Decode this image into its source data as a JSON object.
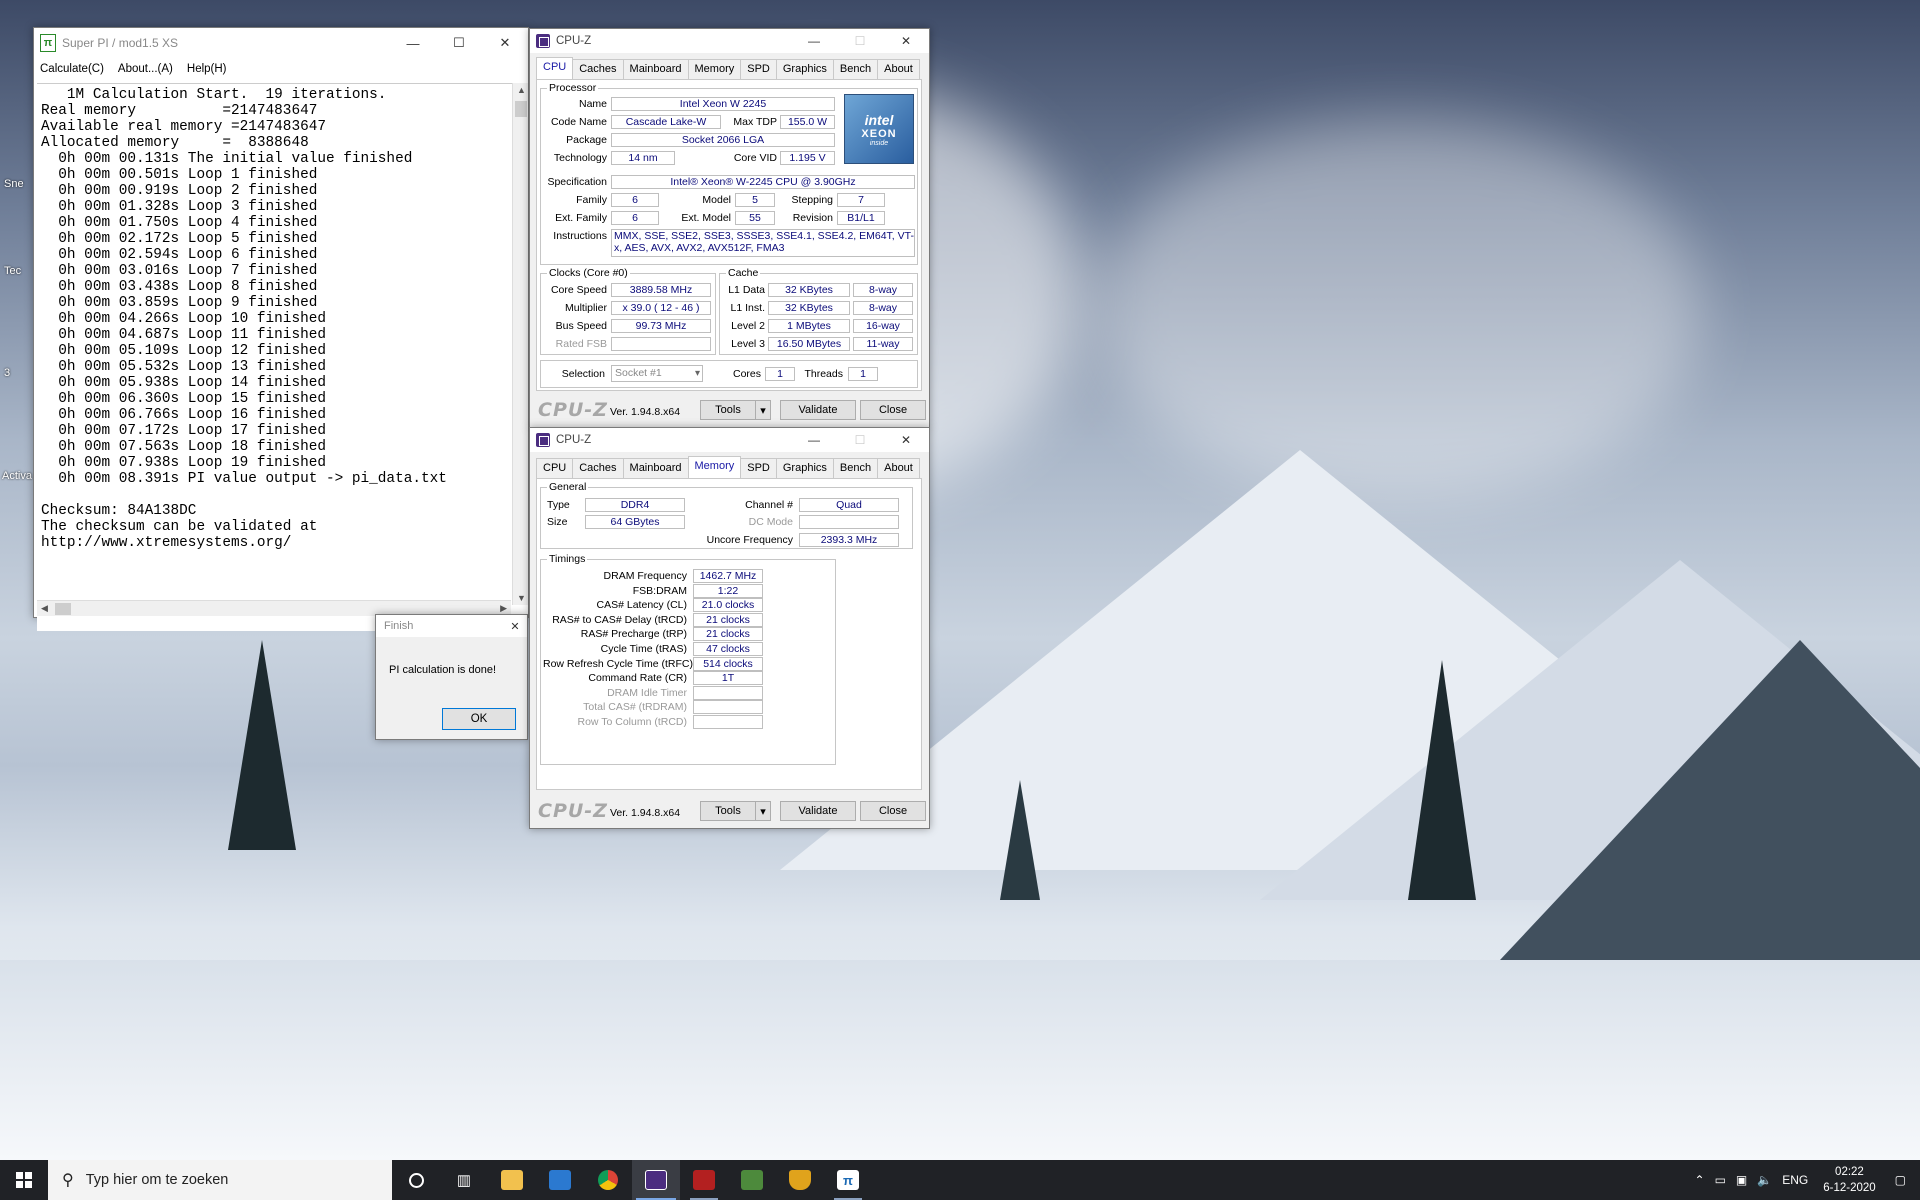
{
  "taskbar": {
    "search_placeholder": "Typ hier om te zoeken",
    "language": "ENG",
    "time": "02:22",
    "date": "6-12-2020"
  },
  "desktop": {
    "icon_fragments": [
      "Sne",
      "Tec",
      "3",
      "Activa"
    ]
  },
  "superpi": {
    "title": "Super PI / mod1.5 XS",
    "menu": [
      "Calculate(C)",
      "About...(A)",
      "Help(H)"
    ],
    "output_lines": [
      "   1M Calculation Start.  19 iterations.",
      "Real memory          =2147483647",
      "Available real memory =2147483647",
      "Allocated memory     =  8388648",
      "  0h 00m 00.131s The initial value finished",
      "  0h 00m 00.501s Loop 1 finished",
      "  0h 00m 00.919s Loop 2 finished",
      "  0h 00m 01.328s Loop 3 finished",
      "  0h 00m 01.750s Loop 4 finished",
      "  0h 00m 02.172s Loop 5 finished",
      "  0h 00m 02.594s Loop 6 finished",
      "  0h 00m 03.016s Loop 7 finished",
      "  0h 00m 03.438s Loop 8 finished",
      "  0h 00m 03.859s Loop 9 finished",
      "  0h 00m 04.266s Loop 10 finished",
      "  0h 00m 04.687s Loop 11 finished",
      "  0h 00m 05.109s Loop 12 finished",
      "  0h 00m 05.532s Loop 13 finished",
      "  0h 00m 05.938s Loop 14 finished",
      "  0h 00m 06.360s Loop 15 finished",
      "  0h 00m 06.766s Loop 16 finished",
      "  0h 00m 07.172s Loop 17 finished",
      "  0h 00m 07.563s Loop 18 finished",
      "  0h 00m 07.938s Loop 19 finished",
      "  0h 00m 08.391s PI value output -> pi_data.txt",
      "",
      "Checksum: 84A138DC",
      "The checksum can be validated at",
      "http://www.xtremesystems.org/"
    ]
  },
  "finish_dialog": {
    "title": "Finish",
    "message": "PI calculation is done!",
    "ok_label": "OK"
  },
  "cpuz_tabs": [
    "CPU",
    "Caches",
    "Mainboard",
    "Memory",
    "SPD",
    "Graphics",
    "Bench",
    "About"
  ],
  "cpuz_common": {
    "title": "CPU-Z",
    "brand": "CPU-Z",
    "version": "Ver. 1.94.8.x64",
    "tools": "Tools",
    "validate": "Validate",
    "close": "Close"
  },
  "cpu_tab": {
    "processor_legend": "Processor",
    "name_label": "Name",
    "name": "Intel Xeon W 2245",
    "codename_label": "Code Name",
    "codename": "Cascade Lake-W",
    "maxtdp_label": "Max TDP",
    "maxtdp": "155.0 W",
    "package_label": "Package",
    "package": "Socket 2066 LGA",
    "technology_label": "Technology",
    "technology": "14 nm",
    "corevid_label": "Core VID",
    "corevid": "1.195 V",
    "spec_label": "Specification",
    "spec": "Intel® Xeon® W-2245 CPU @ 3.90GHz",
    "family_label": "Family",
    "family": "6",
    "model_label": "Model",
    "model": "5",
    "stepping_label": "Stepping",
    "stepping": "7",
    "extfamily_label": "Ext. Family",
    "extfamily": "6",
    "extmodel_label": "Ext. Model",
    "extmodel": "55",
    "revision_label": "Revision",
    "revision": "B1/L1",
    "instructions_label": "Instructions",
    "instructions": "MMX, SSE, SSE2, SSE3, SSSE3, SSE4.1, SSE4.2, EM64T, VT-x, AES, AVX, AVX2, AVX512F, FMA3",
    "clocks_legend": "Clocks (Core #0)",
    "corespeed_label": "Core Speed",
    "corespeed": "3889.58 MHz",
    "multiplier_label": "Multiplier",
    "multiplier": "x 39.0 ( 12 - 46 )",
    "busspeed_label": "Bus Speed",
    "busspeed": "99.73 MHz",
    "ratedfsb_label": "Rated FSB",
    "ratedfsb": "",
    "cache_legend": "Cache",
    "l1data_label": "L1 Data",
    "l1data": "32 KBytes",
    "l1data_way": "8-way",
    "l1inst_label": "L1 Inst.",
    "l1inst": "32 KBytes",
    "l1inst_way": "8-way",
    "l2_label": "Level 2",
    "l2": "1 MBytes",
    "l2_way": "16-way",
    "l3_label": "Level 3",
    "l3": "16.50 MBytes",
    "l3_way": "11-way",
    "selection_label": "Selection",
    "selection": "Socket #1",
    "cores_label": "Cores",
    "cores": "1",
    "threads_label": "Threads",
    "threads": "1",
    "intel_logo": {
      "brand": "intel",
      "product": "XEON",
      "tag": "inside"
    }
  },
  "memory_tab": {
    "general_legend": "General",
    "type_label": "Type",
    "type": "DDR4",
    "size_label": "Size",
    "size": "64 GBytes",
    "channel_label": "Channel #",
    "channel": "Quad",
    "dcmode_label": "DC Mode",
    "dcmode": "",
    "uncore_label": "Uncore Frequency",
    "uncore": "2393.3 MHz",
    "timings_legend": "Timings",
    "timings": [
      {
        "label": "DRAM Frequency",
        "value": "1462.7 MHz",
        "grey": false
      },
      {
        "label": "FSB:DRAM",
        "value": "1:22",
        "grey": false
      },
      {
        "label": "CAS# Latency (CL)",
        "value": "21.0 clocks",
        "grey": false
      },
      {
        "label": "RAS# to CAS# Delay (tRCD)",
        "value": "21 clocks",
        "grey": false
      },
      {
        "label": "RAS# Precharge (tRP)",
        "value": "21 clocks",
        "grey": false
      },
      {
        "label": "Cycle Time (tRAS)",
        "value": "47 clocks",
        "grey": false
      },
      {
        "label": "Row Refresh Cycle Time (tRFC)",
        "value": "514 clocks",
        "grey": false
      },
      {
        "label": "Command Rate (CR)",
        "value": "1T",
        "grey": false
      },
      {
        "label": "DRAM Idle Timer",
        "value": "",
        "grey": true
      },
      {
        "label": "Total CAS# (tRDRAM)",
        "value": "",
        "grey": true
      },
      {
        "label": "Row To Column (tRCD)",
        "value": "",
        "grey": true
      }
    ]
  }
}
